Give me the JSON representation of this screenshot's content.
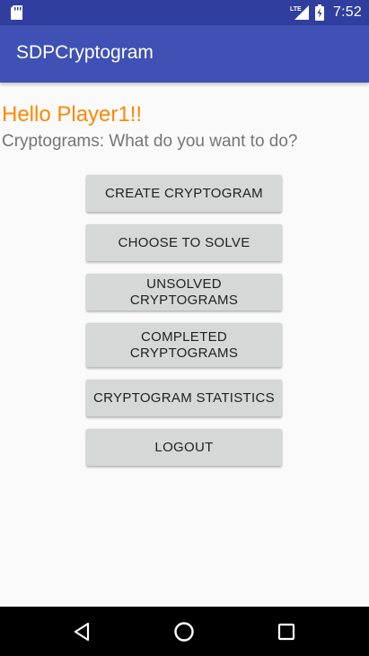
{
  "status_bar": {
    "time": "7:52",
    "network_label": "LTE",
    "icons": [
      "sd-card-icon",
      "lte-signal-icon",
      "battery-icon"
    ]
  },
  "app_bar": {
    "title": "SDPCryptogram"
  },
  "main": {
    "greeting": "Hello Player1!!",
    "prompt": "Cryptograms: What do you want to do?",
    "buttons": [
      {
        "label": "CREATE CRYPTOGRAM"
      },
      {
        "label": "CHOOSE TO SOLVE"
      },
      {
        "label": "UNSOLVED CRYPTOGRAMS"
      },
      {
        "label": "COMPLETED CRYPTOGRAMS"
      },
      {
        "label": "CRYPTOGRAM STATISTICS"
      },
      {
        "label": "LOGOUT"
      }
    ]
  },
  "colors": {
    "status_bar": "#303F9F",
    "app_bar": "#3F51B5",
    "greeting": "#FF8800",
    "button_bg": "#D6D7D7"
  },
  "nav_bar": {
    "icons": [
      "back-icon",
      "home-icon",
      "recents-icon"
    ]
  }
}
